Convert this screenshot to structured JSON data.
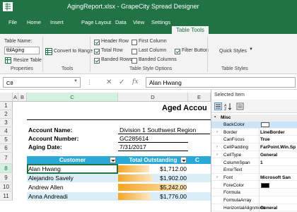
{
  "window": {
    "title": "AgingReport.xlsx - GrapeCity Spread Designer"
  },
  "ribbon_tabs": [
    "File",
    "Home",
    "Insert",
    "Page Layout",
    "Data",
    "View",
    "Settings",
    "Table Tools"
  ],
  "active_tab": "Table Tools",
  "ribbon": {
    "properties": {
      "table_name_label": "Table Name:",
      "table_name_value": "tblAging",
      "resize_label": "Resize Table",
      "group": "Properties"
    },
    "tools": {
      "convert_label": "Convert to Range",
      "group": "Tools"
    },
    "style_options": {
      "header_row": "Header Row",
      "total_row": "Total Row",
      "banded_rows": "Banded Rows",
      "first_column": "First Column",
      "last_column": "Last Column",
      "banded_columns": "Banded Columns",
      "filter_button": "Filter Button",
      "group": "Table Style Options"
    },
    "styles": {
      "quick_styles": "Quick Styles",
      "group": "Table Styles"
    }
  },
  "formula_bar": {
    "cell_ref": "C8",
    "cancel": "✕",
    "enter": "✓",
    "fx": "fx",
    "value": "Alan Hwang"
  },
  "sheet": {
    "columns": [
      "A",
      "B",
      "C",
      "D",
      "E"
    ],
    "rows": [
      "1",
      "2",
      "3",
      "4",
      "5",
      "6",
      "7",
      "8",
      "9",
      "10",
      "11"
    ],
    "title": "Aged Accou",
    "account_name_label": "Account Name:",
    "account_name_value": "Division 1 Southwest Region",
    "account_number_label": "Account Number:",
    "account_number_value": "GC285614",
    "aging_date_label": "Aging Date:",
    "aging_date_value": "7/31/2017",
    "table_headers": [
      "Customer",
      "Total Outstanding",
      "C"
    ],
    "table_rows": [
      {
        "customer": "Alan Hwang",
        "total": "$1,712.00",
        "bar": 0.45
      },
      {
        "customer": "Alejandro Savely",
        "total": "$1,902.00",
        "bar": 0.5
      },
      {
        "customer": "Andrew Allen",
        "total": "$5,242.00",
        "bar": 1.0
      },
      {
        "customer": "Anna Andreadi",
        "total": "$1,776.00",
        "bar": 0.47
      }
    ]
  },
  "property_pane": {
    "title": "Selected Item",
    "category": "Misc",
    "properties": [
      {
        "name": "BackColor",
        "value": "",
        "swatch": "#ffffff",
        "expandable": false
      },
      {
        "name": "Border",
        "value": "LineBorder",
        "expandable": true
      },
      {
        "name": "CanFocus",
        "value": "True",
        "expandable": false
      },
      {
        "name": "CellPadding",
        "value": "FarPoint.Win.Sp",
        "expandable": true
      },
      {
        "name": "CellType",
        "value": "General",
        "expandable": true
      },
      {
        "name": "ColumnSpan",
        "value": "1",
        "expandable": false
      },
      {
        "name": "ErrorText",
        "value": "",
        "expandable": false
      },
      {
        "name": "Font",
        "value": "Microsoft San",
        "expandable": true
      },
      {
        "name": "ForeColor",
        "value": "",
        "swatch": "#000000",
        "expandable": false
      },
      {
        "name": "Formula",
        "value": "",
        "expandable": false
      },
      {
        "name": "FormulaArray",
        "value": "",
        "expandable": false
      },
      {
        "name": "HorizontalAlignment",
        "value": "General",
        "expandable": false
      }
    ]
  },
  "colors": {
    "excel_green": "#217346",
    "table_header": "#29a9d6",
    "band": "#daeef7",
    "databar": "#f5a623"
  }
}
